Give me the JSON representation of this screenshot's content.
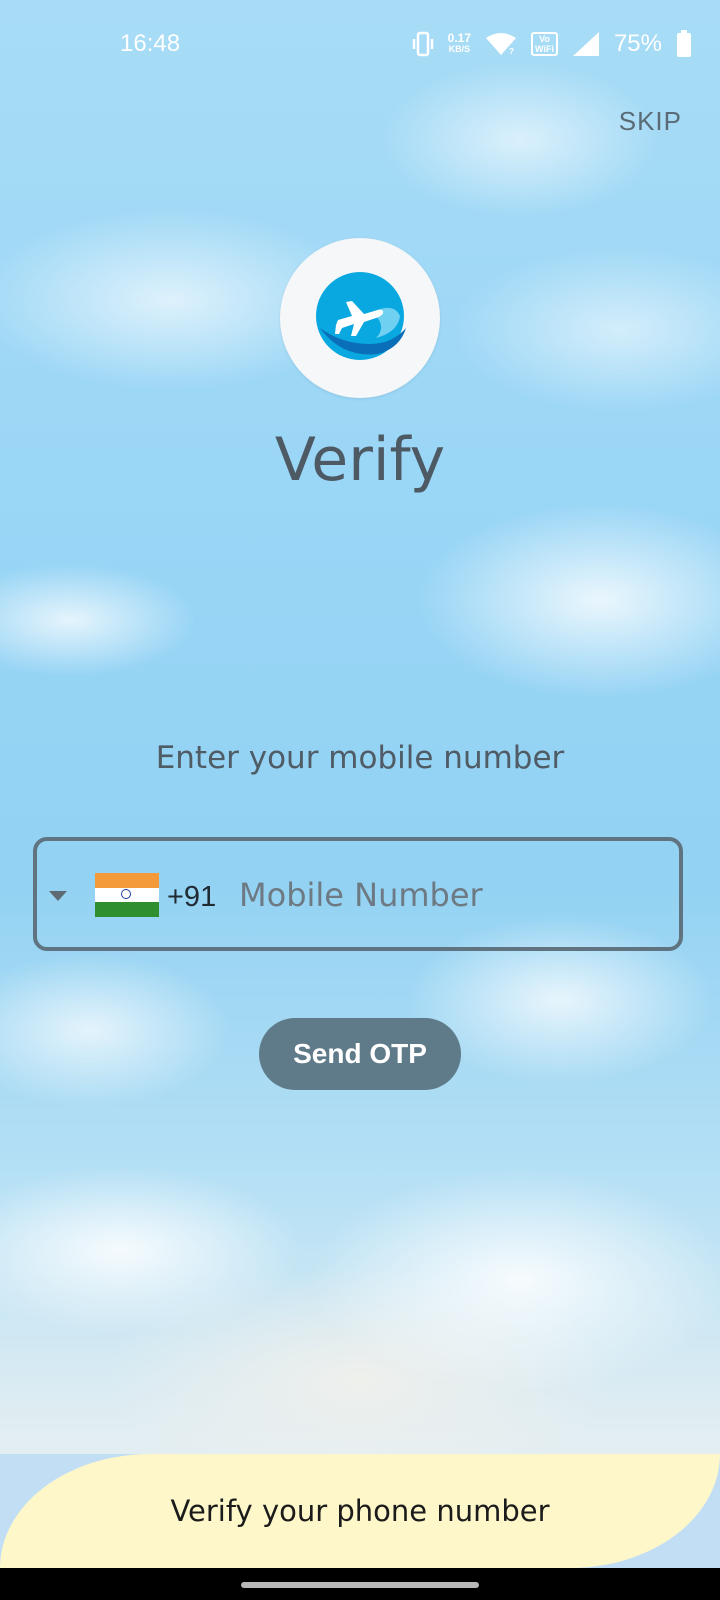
{
  "status_bar": {
    "time": "16:48",
    "net_speed_value": "0.17",
    "net_speed_unit": "KB/S",
    "vowifi_top": "Vo",
    "vowifi_bottom": "WiFi",
    "battery": "75%",
    "icons": [
      "vibrate-icon",
      "wifi-icon",
      "cellular-signal-icon",
      "battery-icon"
    ]
  },
  "header": {
    "skip_label": "SKIP"
  },
  "logo": {
    "icon": "airplane-logo-icon",
    "colors": {
      "primary": "#0aa8e0",
      "dark": "#0a6fb8",
      "light": "#6fd0f2"
    }
  },
  "main": {
    "title": "Verify",
    "prompt": "Enter your mobile number",
    "phone_field": {
      "country_flag": "india-flag-icon",
      "dial_code": "+91",
      "value": "",
      "placeholder": "Mobile Number"
    },
    "send_otp_label": "Send OTP"
  },
  "banner": {
    "text": "Verify your phone number"
  },
  "colors": {
    "accent": "#5f7b89",
    "field_border": "#5f7480",
    "banner_bg": "#fdf7c9",
    "title_text": "#4d5963"
  }
}
